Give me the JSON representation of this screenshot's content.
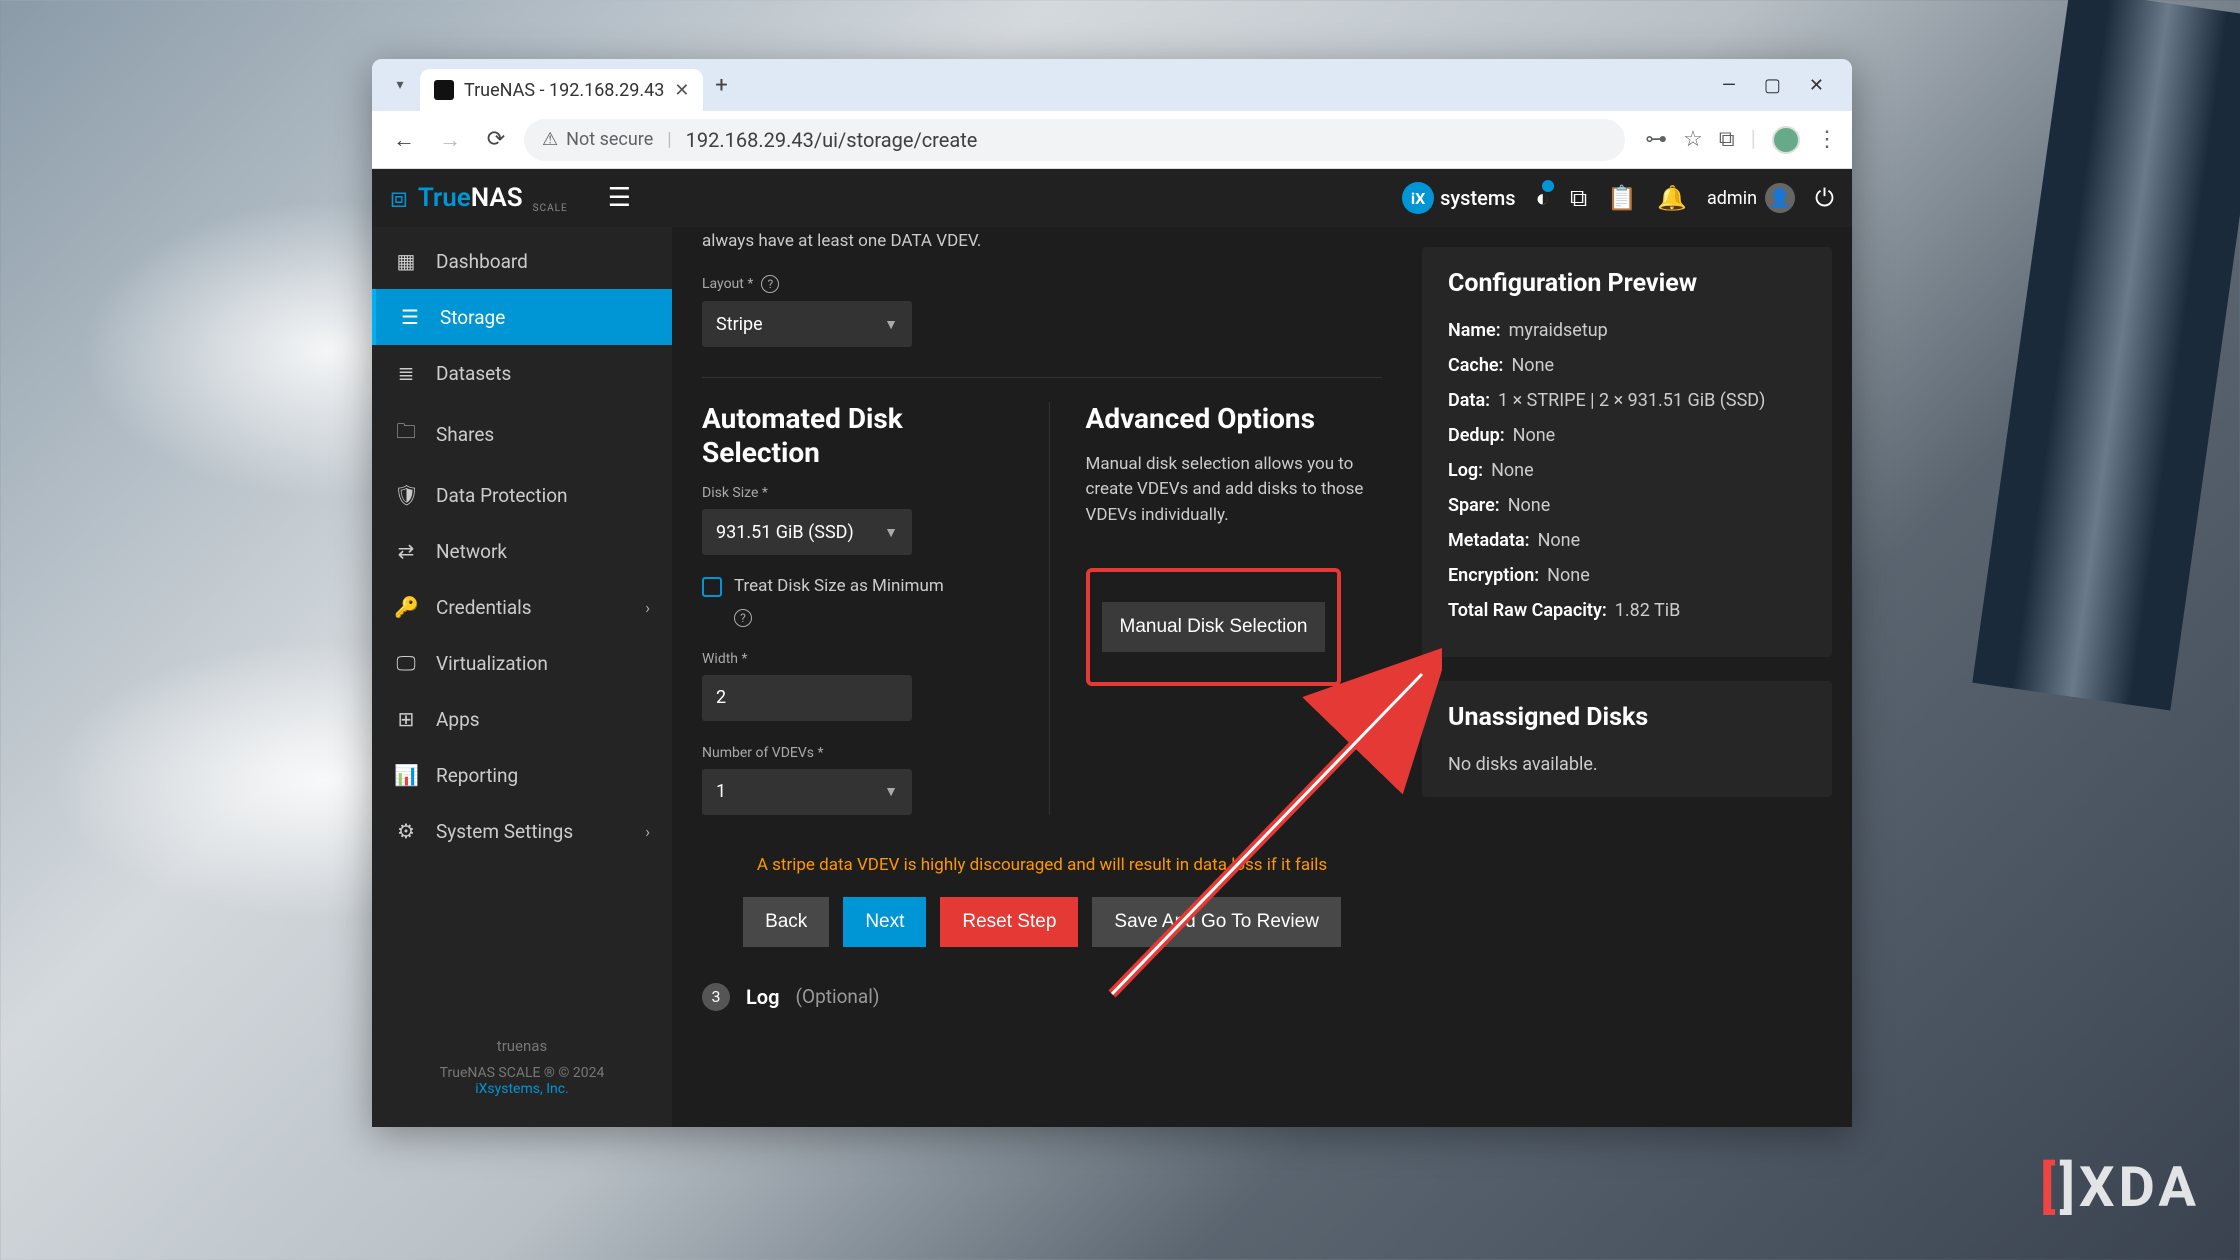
{
  "browser": {
    "tab_title": "TrueNAS - 192.168.29.43",
    "url": "192.168.29.43/ui/storage/create",
    "not_secure": "Not secure"
  },
  "topbar": {
    "brand_true": "True",
    "brand_nas": "NAS",
    "brand_sub": "SCALE",
    "ix_brand": "systems",
    "username": "admin"
  },
  "sidebar": {
    "items": [
      {
        "label": "Dashboard",
        "icon": "▦"
      },
      {
        "label": "Storage",
        "icon": "☰",
        "active": true
      },
      {
        "label": "Datasets",
        "icon": "≣"
      },
      {
        "label": "Shares",
        "icon": "🗀"
      },
      {
        "label": "Data Protection",
        "icon": "🛡"
      },
      {
        "label": "Network",
        "icon": "⇄"
      },
      {
        "label": "Credentials",
        "icon": "🔑",
        "expandable": true
      },
      {
        "label": "Virtualization",
        "icon": "🖵"
      },
      {
        "label": "Apps",
        "icon": "⊞"
      },
      {
        "label": "Reporting",
        "icon": "📊"
      },
      {
        "label": "System Settings",
        "icon": "⚙",
        "expandable": true
      }
    ],
    "footer_name": "truenas",
    "footer_copy": "TrueNAS SCALE ® © 2024",
    "footer_link": "iXsystems, Inc."
  },
  "content": {
    "vdev_desc": "always have at least one DATA VDEV.",
    "layout_label": "Layout *",
    "layout_value": "Stripe",
    "auto_title": "Automated Disk Selection",
    "disk_size_label": "Disk Size *",
    "disk_size_value": "931.51 GiB (SSD)",
    "treat_label": "Treat Disk Size as Minimum",
    "width_label": "Width *",
    "width_value": "2",
    "num_vdevs_label": "Number of VDEVs *",
    "num_vdevs_value": "1",
    "adv_title": "Advanced Options",
    "adv_desc": "Manual disk selection allows you to create VDEVs and add disks to those VDEVs individually.",
    "manual_btn": "Manual Disk Selection",
    "warning": "A stripe data VDEV is highly discouraged and will result in data loss if it fails",
    "btn_back": "Back",
    "btn_next": "Next",
    "btn_reset": "Reset Step",
    "btn_save": "Save And Go To Review",
    "step3_num": "3",
    "step3_title": "Log",
    "step3_opt": "(Optional)"
  },
  "preview": {
    "title": "Configuration Preview",
    "rows": [
      {
        "label": "Name:",
        "value": "myraidsetup"
      },
      {
        "label": "Cache:",
        "value": "None"
      },
      {
        "label": "Data:",
        "value": "1 × STRIPE | 2 × 931.51 GiB (SSD)"
      },
      {
        "label": "Dedup:",
        "value": "None"
      },
      {
        "label": "Log:",
        "value": "None"
      },
      {
        "label": "Spare:",
        "value": "None"
      },
      {
        "label": "Metadata:",
        "value": "None"
      },
      {
        "label": "Encryption:",
        "value": "None"
      },
      {
        "label": "Total Raw Capacity:",
        "value": "1.82 TiB"
      }
    ]
  },
  "unassigned": {
    "title": "Unassigned Disks",
    "text": "No disks available."
  }
}
